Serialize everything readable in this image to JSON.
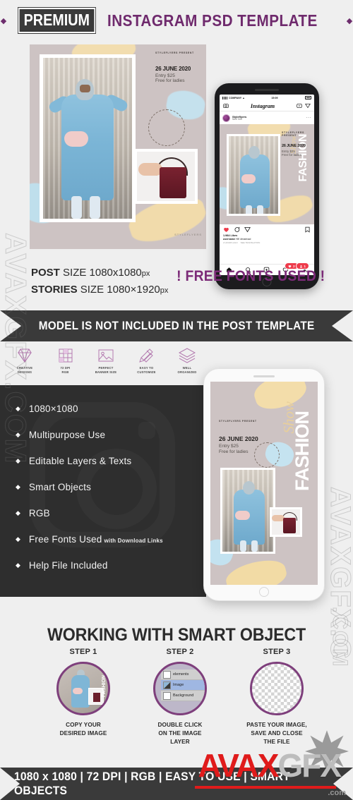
{
  "header": {
    "diamond_left": "◆",
    "badge": "PREMIUM",
    "rest": "INSTAGRAM  PSD TEMPLATE",
    "diamond_right": "◆",
    "accent_purple": "#6f2a6d",
    "badge_bg": "#3a3a3a"
  },
  "post_preview": {
    "present": "STYLEFLYERS PRESENT",
    "date": "26 JUNE 2020",
    "entry": "Entry $25",
    "free": "Free for ladies",
    "corner_mark": "STYLEFLYERS"
  },
  "phone_instagram": {
    "status": {
      "carrier": "COMPANY",
      "time": "15:09"
    },
    "app_title": "Instagram",
    "camera_icon": "camera-icon",
    "tv_icon": "igtv-icon",
    "send_icon": "send-icon",
    "username": "Styleflyers",
    "location": "New York",
    "more": "···",
    "post": {
      "fashion": "FASHION",
      "show": "Show",
      "present": "STYLEFLYERS PRESENT",
      "date": "26 JUNE 2020",
      "entry": "Entry $25",
      "free": "Free for ladies"
    },
    "likes": "1.984 Likes",
    "caption_user": "username",
    "caption_text": "Hi!! #marinad",
    "time_ago": "2 HOURS AGO",
    "see_translation": "SEE TRANSLATION",
    "badge_likes": "2",
    "badge_follow": "1",
    "badge_color": "#ee3b4b",
    "tabs": [
      "home-icon",
      "search-icon",
      "add-icon",
      "heart-icon",
      "profile-icon"
    ]
  },
  "sizes": {
    "post_label": "POST",
    "post_value": "SIZE 1080x1080",
    "post_unit": "px",
    "stories_label": "STORIES",
    "stories_value": "SIZE 1080×1920",
    "stories_unit": "px",
    "free_fonts": "! FREE FONTS USED !"
  },
  "ribbon": {
    "text": "MODEL IS NOT INCLUDED  IN THE POST TEMPLATE"
  },
  "features_icons": [
    {
      "icon": "diamond-icon",
      "line1": "CREATIVE",
      "line2": "DESIGNS"
    },
    {
      "icon": "grid-icon",
      "line1": "72 DPI",
      "line2": "RGB"
    },
    {
      "icon": "image-icon",
      "line1": "PERFECT",
      "line2": "BANNER SIZE"
    },
    {
      "icon": "pencil-ruler-icon",
      "line1": "EASY TO",
      "line2": "CUSTOMIZE"
    },
    {
      "icon": "layers-icon",
      "line1": "WELL",
      "line2": "ORGANIZED"
    }
  ],
  "feature_list": {
    "bullet": "◆",
    "items": [
      {
        "text": "1080×1080",
        "sub": ""
      },
      {
        "text": "Multipurpose Use",
        "sub": ""
      },
      {
        "text": "Editable  Layers & Texts",
        "sub": ""
      },
      {
        "text": "Smart Objects",
        "sub": ""
      },
      {
        "text": "RGB",
        "sub": ""
      },
      {
        "text": "Free Fonts Used",
        "sub": "with Download Links"
      },
      {
        "text": "Help File Included",
        "sub": ""
      }
    ]
  },
  "phone_stories": {
    "present": "STYLEFLYERS PRESENT",
    "date": "26 JUNE 2020",
    "entry": "Entry $25",
    "free": "Free for ladies",
    "fashion": "FASHION",
    "show": "Show"
  },
  "smart_object": {
    "title": "WORKING WITH SMART OBJECT",
    "accent": "#7e3f7c",
    "steps": [
      {
        "title": "STEP 1",
        "caption_l1": "COPY YOUR",
        "caption_l2": "DESIRED IMAGE",
        "caption_l3": "",
        "thumb_word": "FASHION"
      },
      {
        "title": "STEP 2",
        "caption_l1": "DOUBLE CLICK",
        "caption_l2": "ON THE IMAGE",
        "caption_l3": "LAYER",
        "layers": [
          {
            "name": "elements",
            "selected": false
          },
          {
            "name": "Image",
            "selected": true
          },
          {
            "name": "Background",
            "selected": false
          }
        ]
      },
      {
        "title": "STEP 3",
        "caption_l1": "PASTE YOUR IMAGE,",
        "caption_l2": "SAVE AND CLOSE",
        "caption_l3": "THE FILE"
      }
    ]
  },
  "footer": {
    "text": "1080 x 1080  |  72 DPI  |  RGB  |  EASY TO USE  |  SMART OBJECTS"
  },
  "watermarks": {
    "left": "AVAXGFX.COM",
    "right": "AVAXGFX.C",
    "right2": ".COM",
    "red_brand": "AVAX",
    "red_brand_grey": "GFX",
    "red_com": ".com"
  }
}
